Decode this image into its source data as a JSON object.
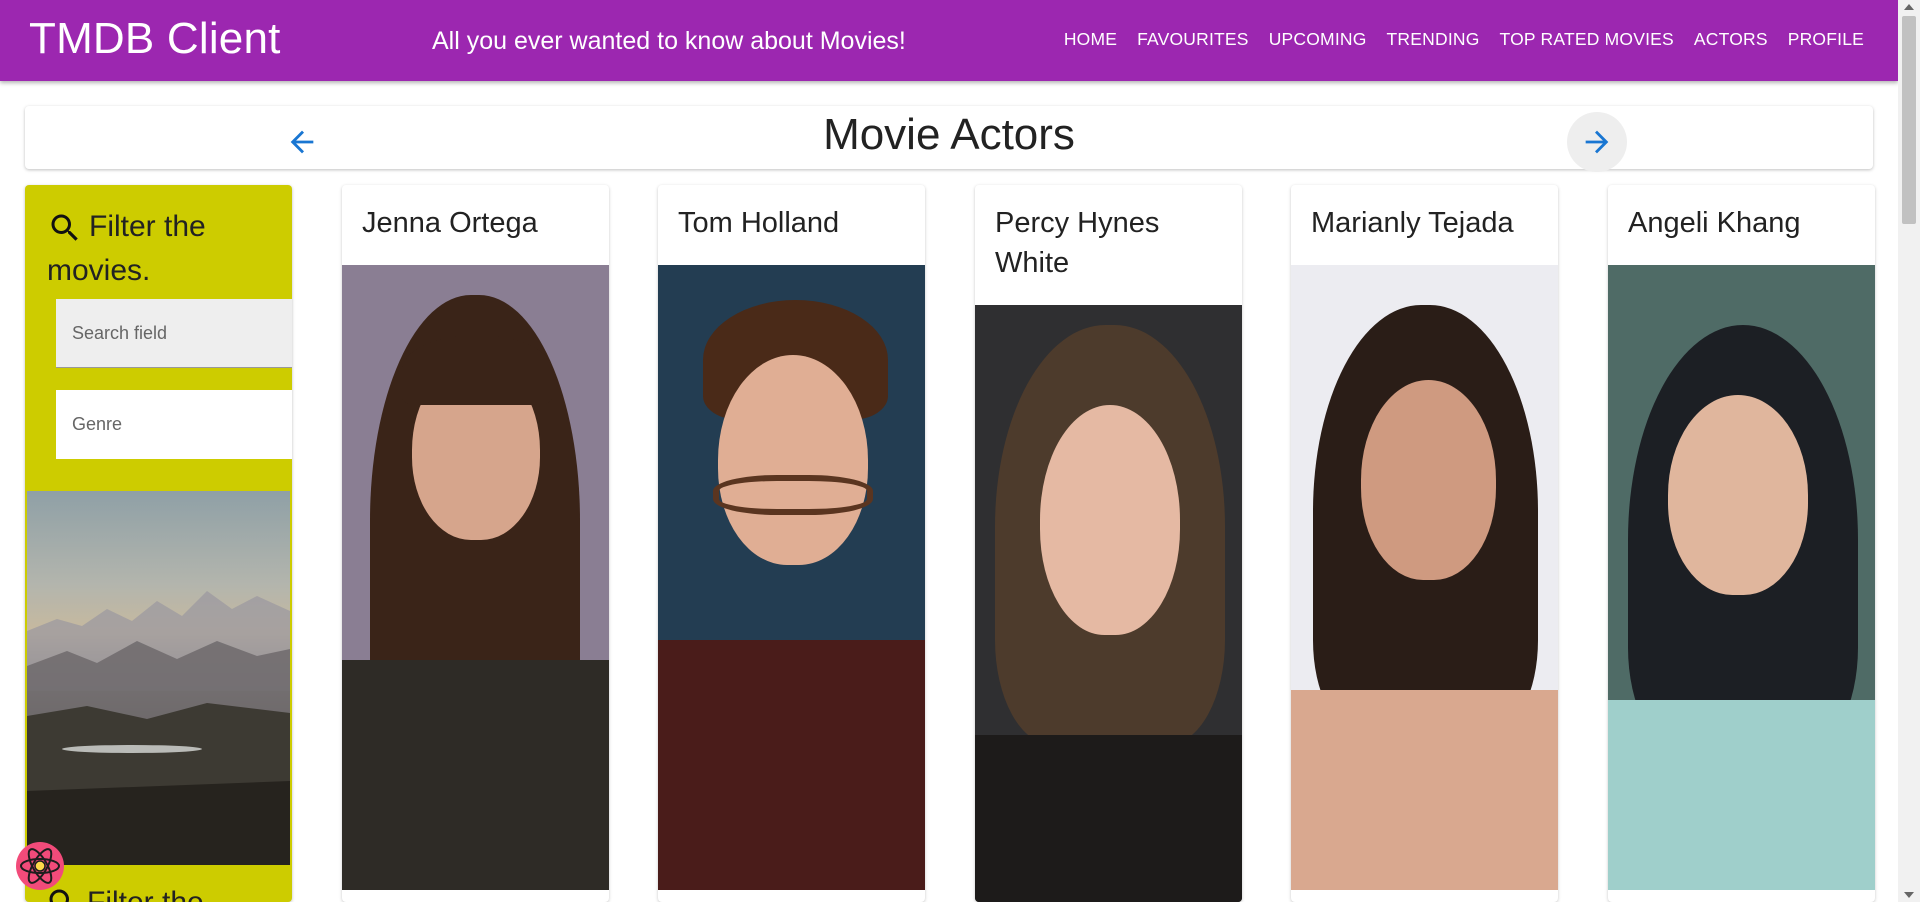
{
  "appbar": {
    "title": "TMDB Client",
    "subtitle": "All you ever wanted to know about Movies!",
    "nav": [
      "Home",
      "Favourites",
      "Upcoming",
      "Trending",
      "Top Rated Movies",
      "Actors",
      "Profile"
    ],
    "color": "#9c27b0"
  },
  "header": {
    "title": "Movie Actors",
    "back_icon": "arrow-left-icon",
    "forward_icon": "arrow-right-icon"
  },
  "filter": {
    "heading": "Filter the movies.",
    "search_placeholder": "Search field",
    "genre_placeholder": "Genre",
    "footer_heading": "Filter the",
    "color": "#cdcc00"
  },
  "actors": [
    {
      "name": "Jenna Ortega"
    },
    {
      "name": "Tom Holland"
    },
    {
      "name": "Percy Hynes White"
    },
    {
      "name": "Marianly Tejada"
    },
    {
      "name": "Angeli Khang"
    }
  ]
}
